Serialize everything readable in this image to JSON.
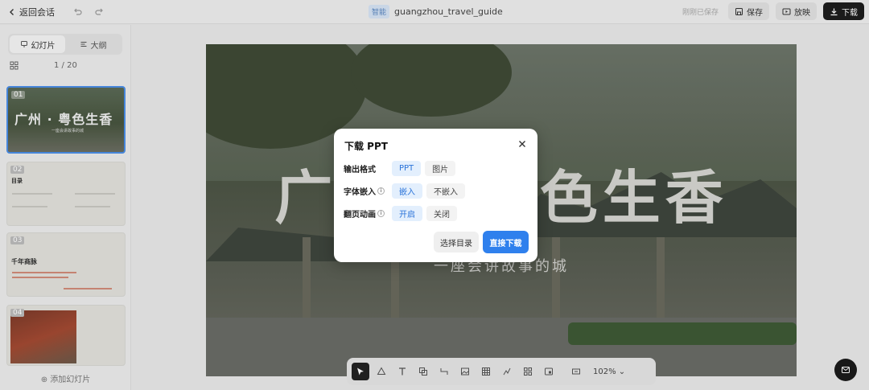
{
  "topbar": {
    "back_label": "返回会话",
    "doc_tag": "智能",
    "doc_name": "guangzhou_travel_guide",
    "saved_status": "刚刚已保存",
    "save_label": "保存",
    "present_label": "放映",
    "download_label": "下载"
  },
  "sidebar": {
    "tabs": [
      {
        "label": "幻灯片",
        "icon": "slides-icon",
        "active": true
      },
      {
        "label": "大纲",
        "icon": "outline-icon",
        "active": false
      }
    ],
    "page_counter": "1 / 20",
    "slides": [
      {
        "num": "01",
        "title": "广州 · 粤色生香",
        "subtitle": "一座会讲故事的城"
      },
      {
        "num": "02",
        "title": "目录"
      },
      {
        "num": "03",
        "title": "千年商脉"
      },
      {
        "num": "04"
      }
    ],
    "add_slide_label": "添加幻灯片"
  },
  "slide": {
    "title": "广州 · 粤色生香",
    "subtitle": "一座会讲故事的城"
  },
  "toolbar": {
    "zoom": "102%",
    "tools": [
      "pointer-icon",
      "shape-icon",
      "text-icon",
      "copy-icon",
      "connector-icon",
      "image-icon",
      "table-icon",
      "chart-icon",
      "grid-icon",
      "media-icon",
      "fit-icon"
    ]
  },
  "modal": {
    "title": "下载 PPT",
    "rows": [
      {
        "label": "输出格式",
        "has_info": false,
        "options": [
          "PPT",
          "图片"
        ],
        "selected": 0
      },
      {
        "label": "字体嵌入",
        "has_info": true,
        "options": [
          "嵌入",
          "不嵌入"
        ],
        "selected": 0
      },
      {
        "label": "翻页动画",
        "has_info": true,
        "options": [
          "开启",
          "关闭"
        ],
        "selected": 0
      }
    ],
    "secondary_button": "选择目录",
    "primary_button": "直接下载"
  },
  "colors": {
    "accent": "#2f80ed",
    "chip_selected_bg": "#e3effd",
    "dark_button": "#1d1d1d"
  }
}
